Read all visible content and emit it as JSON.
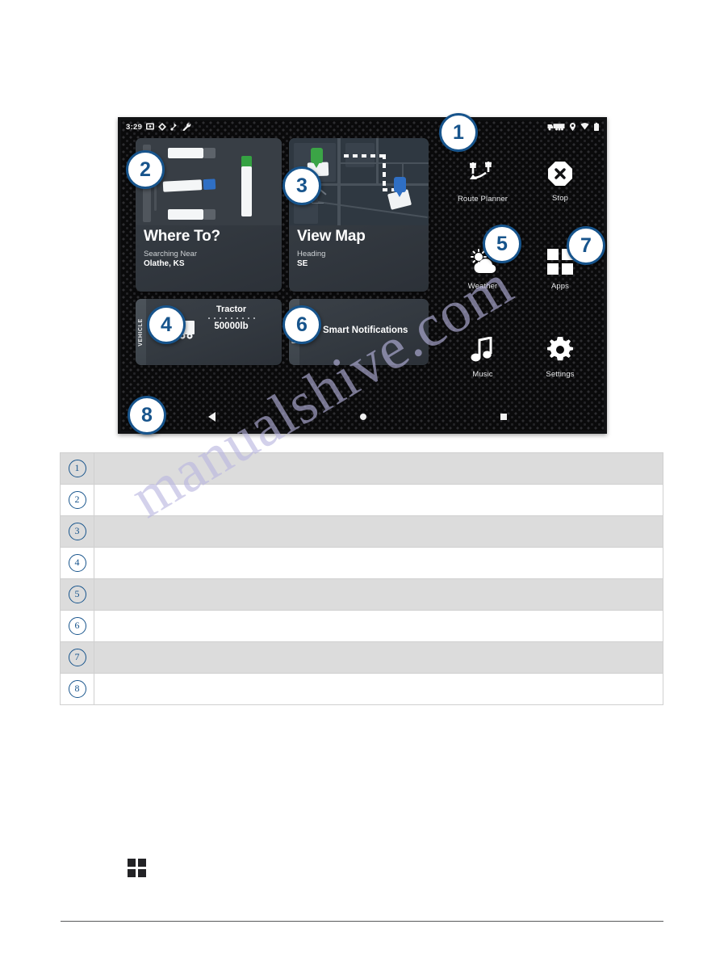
{
  "device": {
    "status_bar": {
      "time": "3:29",
      "left_icons": [
        "screenshot-icon",
        "navigation-icon",
        "bluetooth-audio-icon",
        "wrench-icon"
      ],
      "right_icons": [
        "truck-profile-icon",
        "location-icon",
        "wifi-icon",
        "battery-icon"
      ]
    },
    "cards": [
      {
        "id": "where-to",
        "title": "Where To?",
        "sub_label": "Searching Near",
        "sub_value": "Olathe, KS"
      },
      {
        "id": "view-map",
        "title": "View Map",
        "sub_label": "Heading",
        "sub_value": "SE"
      },
      {
        "id": "vehicle",
        "side_label": "VEHICLE",
        "title": "Tractor",
        "value": "50000lb"
      },
      {
        "id": "phone",
        "side_label": "PHONE",
        "title": "Smart Notifications"
      }
    ],
    "shortcuts": [
      {
        "label": "Route Planner",
        "icon": "route-planner-icon"
      },
      {
        "label": "Stop",
        "icon": "stop-octagon-icon"
      },
      {
        "label": "Weather",
        "icon": "weather-partly-cloudy-icon"
      },
      {
        "label": "Apps",
        "icon": "apps-grid-icon"
      },
      {
        "label": "Music",
        "icon": "music-note-icon"
      },
      {
        "label": "Settings",
        "icon": "gear-icon"
      }
    ],
    "nav_bar": {
      "back": "back-triangle-icon",
      "home": "home-circle-icon",
      "recents": "recents-square-icon"
    }
  },
  "callouts": [
    {
      "n": "1"
    },
    {
      "n": "2"
    },
    {
      "n": "3"
    },
    {
      "n": "4"
    },
    {
      "n": "5"
    },
    {
      "n": "6"
    },
    {
      "n": "7"
    },
    {
      "n": "8"
    }
  ],
  "legend": {
    "rows": [
      {
        "num": "1",
        "desc": ""
      },
      {
        "num": "2",
        "desc": ""
      },
      {
        "num": "3",
        "desc": ""
      },
      {
        "num": "4",
        "desc": ""
      },
      {
        "num": "5",
        "desc": ""
      },
      {
        "num": "6",
        "desc": ""
      },
      {
        "num": "7",
        "desc": ""
      },
      {
        "num": "8",
        "desc": ""
      }
    ]
  },
  "body": {
    "apps_icon": "apps-grid-icon"
  },
  "watermark": {
    "text": "manualshive.com"
  },
  "colors": {
    "callout_blue": "#17548c",
    "accent_green": "#3ba446",
    "accent_blue": "#2f6fc4",
    "screen_black": "#0a0a0b",
    "card_gray": "#333940",
    "table_shade": "#dcdcdc"
  }
}
